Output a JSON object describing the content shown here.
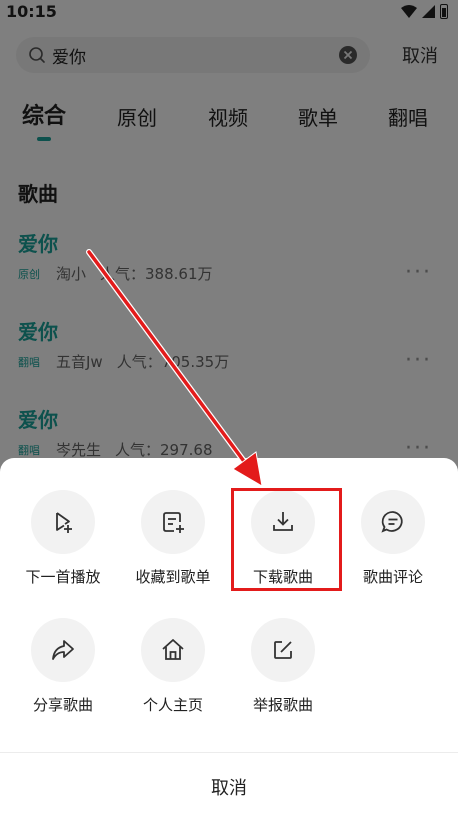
{
  "status_bar": {
    "time": "10:15"
  },
  "search": {
    "query": "爱你",
    "cancel_label": "取消"
  },
  "tabs": [
    {
      "label": "综合",
      "active": true
    },
    {
      "label": "原创",
      "active": false
    },
    {
      "label": "视频",
      "active": false
    },
    {
      "label": "歌单",
      "active": false
    },
    {
      "label": "翻唱",
      "active": false
    }
  ],
  "section_title": "歌曲",
  "songs": [
    {
      "title": "爱你",
      "tag": "原创",
      "artist": "淘小",
      "popularity": "人气：388.61万"
    },
    {
      "title": "爱你",
      "tag": "翻唱",
      "artist": "五音Jw",
      "popularity": "人气：705.35万"
    },
    {
      "title": "爱你",
      "tag": "翻唱",
      "artist": "岑先生",
      "popularity": "人气：297.68"
    }
  ],
  "sheet": {
    "actions": [
      {
        "label": "下一首播放",
        "icon": "play-next-icon"
      },
      {
        "label": "收藏到歌单",
        "icon": "add-to-playlist-icon"
      },
      {
        "label": "下载歌曲",
        "icon": "download-icon"
      },
      {
        "label": "歌曲评论",
        "icon": "comment-icon"
      },
      {
        "label": "分享歌曲",
        "icon": "share-icon"
      },
      {
        "label": "个人主页",
        "icon": "home-icon"
      },
      {
        "label": "举报歌曲",
        "icon": "report-icon"
      }
    ],
    "cancel_label": "取消"
  },
  "colors": {
    "accent": "#1aa39a",
    "annotation": "#e31b1b"
  }
}
